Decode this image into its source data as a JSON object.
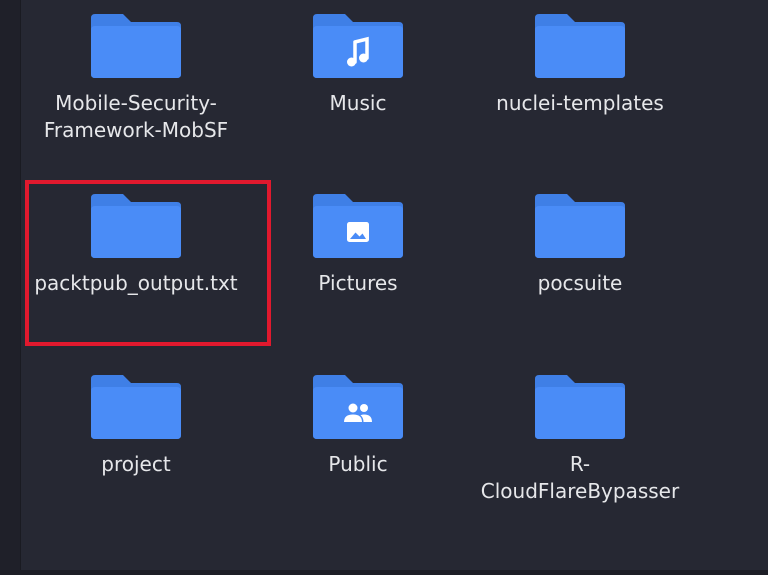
{
  "file_manager": {
    "items": [
      {
        "id": "mobsf",
        "label_lines": [
          "Mobile-Security-",
          "Framework-MobSF"
        ],
        "type": "folder",
        "emblem": ""
      },
      {
        "id": "music",
        "label_lines": [
          "Music"
        ],
        "type": "folder",
        "emblem": "music-note-icon"
      },
      {
        "id": "nuclei",
        "label_lines": [
          "nuclei-templates"
        ],
        "type": "folder",
        "emblem": ""
      },
      {
        "id": "packtpub",
        "label_lines": [
          "packtpub_output.txt"
        ],
        "type": "folder",
        "emblem": ""
      },
      {
        "id": "pictures",
        "label_lines": [
          "Pictures"
        ],
        "type": "folder",
        "emblem": "image-icon"
      },
      {
        "id": "pocsuite",
        "label_lines": [
          "pocsuite"
        ],
        "type": "folder",
        "emblem": ""
      },
      {
        "id": "project",
        "label_lines": [
          "project"
        ],
        "type": "folder",
        "emblem": ""
      },
      {
        "id": "public",
        "label_lines": [
          "Public"
        ],
        "type": "folder",
        "emblem": "people-icon"
      },
      {
        "id": "r-cfb",
        "label_lines": [
          "R-",
          "CloudFlareBypasser"
        ],
        "type": "folder",
        "emblem": ""
      }
    ]
  },
  "colors": {
    "background": "#262833",
    "folder_front": "#4a8cf7",
    "folder_back": "#3f7fe6",
    "label_text": "#e6e7ea",
    "highlight": "#e0192e"
  }
}
